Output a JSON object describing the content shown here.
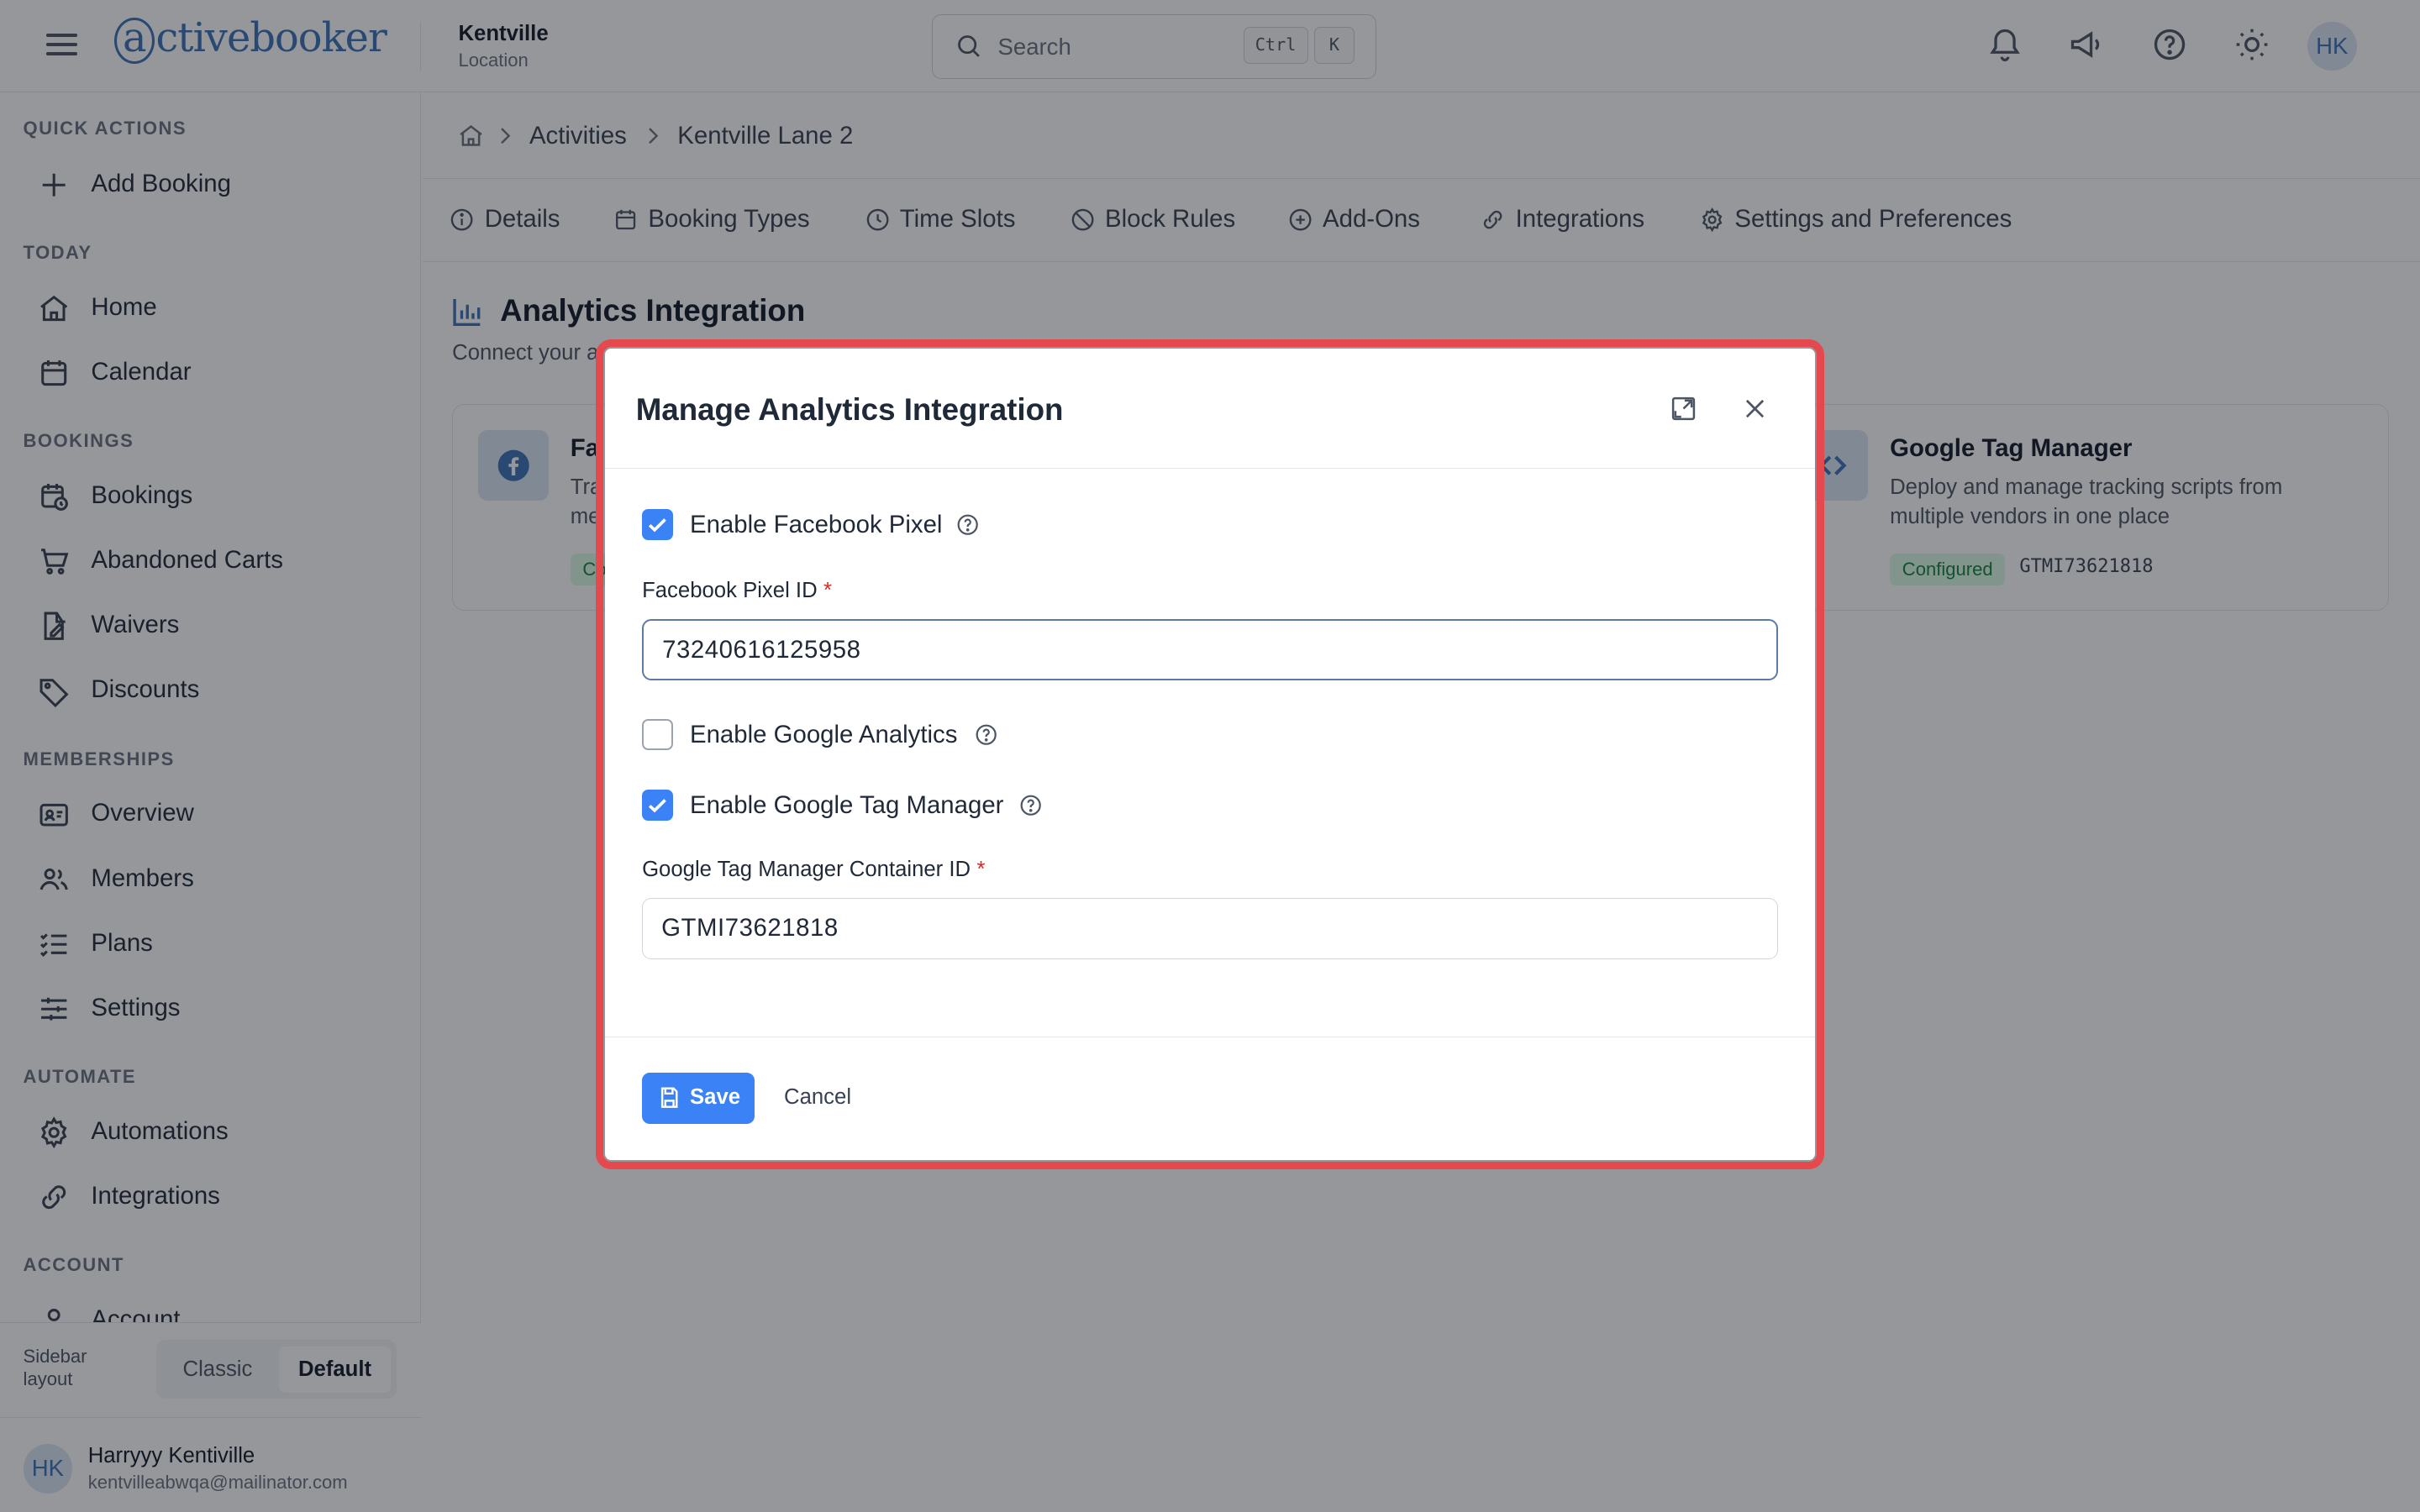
{
  "topbar": {
    "logo_text": "activebooker",
    "location_name": "Kentville",
    "location_sub": "Location",
    "search_placeholder": "Search",
    "kbd_ctrl": "Ctrl",
    "kbd_k": "K",
    "avatar_initials": "HK"
  },
  "sidebar": {
    "sections": {
      "quick_actions": "QUICK ACTIONS",
      "today": "TODAY",
      "bookings": "BOOKINGS",
      "memberships": "MEMBERSHIPS",
      "automate": "AUTOMATE",
      "account": "ACCOUNT"
    },
    "items": {
      "add_booking": "Add Booking",
      "home": "Home",
      "calendar": "Calendar",
      "bookings": "Bookings",
      "abandoned_carts": "Abandoned Carts",
      "waivers": "Waivers",
      "discounts": "Discounts",
      "overview": "Overview",
      "members": "Members",
      "plans": "Plans",
      "settings": "Settings",
      "automations": "Automations",
      "integrations": "Integrations",
      "account": "Account"
    },
    "layout_label": "Sidebar layout",
    "layout_options": [
      "Classic",
      "Default"
    ],
    "layout_selected": "Default",
    "user_initials": "HK",
    "user_name": "Harryyy Kentiville",
    "user_email": "kentvilleabwqa@mailinator.com"
  },
  "breadcrumb": [
    "Activities",
    "Kentville Lane 2"
  ],
  "tabs": [
    "Details",
    "Booking Types",
    "Time Slots",
    "Block Rules",
    "Add-Ons",
    "Integrations",
    "Settings and Preferences"
  ],
  "analytics": {
    "title": "Analytics Integration",
    "description_visible": "Connect your a",
    "cards": {
      "facebook": {
        "title_visible": "Fa",
        "desc_visible": [
          "Tra",
          "me"
        ],
        "badge_visible": "Co"
      },
      "gtm": {
        "title": "Google Tag Manager",
        "description": "Deploy and manage tracking scripts from multiple vendors in one place",
        "badge": "Configured",
        "code": "GTMI73621818"
      }
    }
  },
  "modal": {
    "title": "Manage Analytics Integration",
    "facebook_pixel": {
      "label": "Enable Facebook Pixel",
      "checked": true
    },
    "facebook_id": {
      "label": "Facebook Pixel ID",
      "required_mark": "*",
      "value": "73240616125958"
    },
    "google_analytics": {
      "label": "Enable Google Analytics",
      "checked": false
    },
    "gtm": {
      "label": "Enable Google Tag Manager",
      "checked": true
    },
    "gtm_id": {
      "label": "Google Tag Manager Container ID",
      "required_mark": "*",
      "value": "GTMI73621818"
    },
    "save_label": "Save",
    "cancel_label": "Cancel"
  },
  "colors": {
    "accent": "#3b82f6",
    "brand": "#3b6fb6",
    "highlight": "#e5484d",
    "badge_bg": "#dcfce7",
    "badge_text": "#15803d"
  }
}
